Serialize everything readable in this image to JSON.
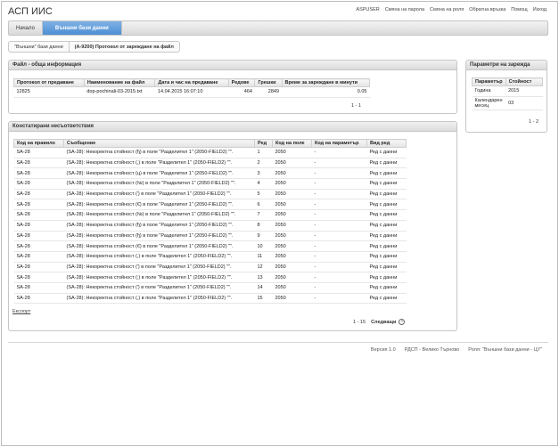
{
  "app": {
    "title": "АСП ИИС"
  },
  "toplinks": [
    "ASPUSER",
    "Смяна на парола",
    "Смяна на роля",
    "Обратна връзка",
    "Помощ",
    "Изход"
  ],
  "nav": {
    "home": "Начало",
    "external": "Външни бази данни"
  },
  "breadcrumb": {
    "parent": "\"Външни\" бази данни",
    "current": "(А-9200) Протокол от зареждане на файл"
  },
  "file_info": {
    "title": "Файл - обща информация",
    "headers": [
      "Протокол от предаване",
      "Наименование на файл",
      "Дата и час на предаване",
      "Редове",
      "Грешки",
      "Време за зареждане в минути"
    ],
    "row": [
      "12825",
      "dop-pochinali-03-2015.txt",
      "14.04.2015 16:07:10",
      "464",
      "2849",
      "0.05"
    ],
    "pager": "1 - 1"
  },
  "params": {
    "title": "Параметри на зарежда",
    "headers": [
      "Параметър",
      "Стойност"
    ],
    "rows": [
      [
        "Година",
        "2015"
      ],
      [
        "Календарен месец",
        "03"
      ]
    ],
    "pager": "1 - 2"
  },
  "errors": {
    "title": "Констатирани несъответствия",
    "headers": [
      "Код на правило",
      "Съобщение",
      "Ред",
      "Код на поле",
      "Код на параметър",
      "Вид ред"
    ],
    "rows": [
      [
        "SA-28",
        "(SA-28): Некоректна стойност (ђ) в поле \"Разделител 1\" (2050-FIELD2) \"\".",
        "1",
        "2050",
        "-",
        "Ред с данни"
      ],
      [
        "SA-28",
        "(SA-28): Некоректна стойност (,) в поле \"Разделител 1\" (2050-FIELD2) \"\".",
        "2",
        "2050",
        "-",
        "Ред с данни"
      ],
      [
        "SA-28",
        "(SA-28): Некоректна стойност (ц) в поле \"Разделител 1\" (2050-FIELD2) \"\".",
        "3",
        "2050",
        "-",
        "Ред с данни"
      ],
      [
        "SA-28",
        "(SA-28): Некоректна стойност (№) в поле \"Разделител 1\" (2050-FIELD2) \"\".",
        "4",
        "2050",
        "-",
        "Ред с данни"
      ],
      [
        "SA-28",
        "(SA-28): Некоректна стойност (') в поле \"Разделител 1\" (2050-FIELD2) \"\".",
        "5",
        "2050",
        "-",
        "Ред с данни"
      ],
      [
        "SA-28",
        "(SA-28): Некоректна стойност (€) в поле \"Разделител 1\" (2050-FIELD2) \"\".",
        "6",
        "2050",
        "-",
        "Ред с данни"
      ],
      [
        "SA-28",
        "(SA-28): Некоректна стойност (№) в поле \"Разделител 1\" (2050-FIELD2) \"\".",
        "7",
        "2050",
        "-",
        "Ред с данни"
      ],
      [
        "SA-28",
        "(SA-28): Некоректна стойност (ђ) в поле \"Разделител 1\" (2050-FIELD2) \"\".",
        "8",
        "2050",
        "-",
        "Ред с данни"
      ],
      [
        "SA-28",
        "(SA-28): Некоректна стойност (ђ) в поле \"Разделител 1\" (2050-FIELD2) \"\".",
        "9",
        "2050",
        "-",
        "Ред с данни"
      ],
      [
        "SA-28",
        "(SA-28): Некоректна стойност (€) в поле \"Разделител 1\" (2050-FIELD2) \"\".",
        "10",
        "2050",
        "-",
        "Ред с данни"
      ],
      [
        "SA-28",
        "(SA-28): Некоректна стойност (,) в поле \"Разделител 1\" (2050-FIELD2) \"\".",
        "11",
        "2050",
        "-",
        "Ред с данни"
      ],
      [
        "SA-28",
        "(SA-28): Некоректна стойност (') в поле \"Разделител 1\" (2050-FIELD2) \"\".",
        "12",
        "2050",
        "-",
        "Ред с данни"
      ],
      [
        "SA-28",
        "(SA-28): Некоректна стойност (;) в поле \"Разделител 1\" (2050-FIELD2) \"\".",
        "13",
        "2050",
        "-",
        "Ред с данни"
      ],
      [
        "SA-28",
        "(SA-28): Некоректна стойност (') в поле \"Разделител 1\" (2050-FIELD2) \"\".",
        "14",
        "2050",
        "-",
        "Ред с данни"
      ],
      [
        "SA-28",
        "(SA-28): Некоректна стойност (,) в поле \"Разделител 1\" (2050-FIELD2) \"\".",
        "15",
        "2050",
        "-",
        "Ред с данни"
      ]
    ],
    "export_label": "Експорт",
    "pager": "1 - 15",
    "next_label": "Следващи"
  },
  "footer": [
    "Версия 1.0",
    "РДСП - Велико Търново",
    "Роля: \"Външни бази данни - ЦУ\""
  ],
  "colors": {
    "accent": "#4d8ed3"
  }
}
